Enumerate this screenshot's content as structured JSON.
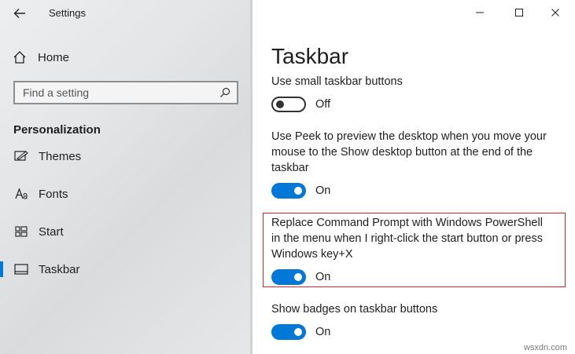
{
  "window": {
    "title": "Settings",
    "controls": [
      "minimize",
      "maximize",
      "close"
    ]
  },
  "sidebar": {
    "home_label": "Home",
    "search": {
      "placeholder": "Find a setting",
      "value": ""
    },
    "section_title": "Personalization",
    "items": [
      {
        "label": "Themes",
        "icon": "themes-icon",
        "active": false
      },
      {
        "label": "Fonts",
        "icon": "fonts-icon",
        "active": false
      },
      {
        "label": "Start",
        "icon": "start-icon",
        "active": false
      },
      {
        "label": "Taskbar",
        "icon": "taskbar-icon",
        "active": true
      }
    ]
  },
  "main": {
    "title": "Taskbar",
    "settings": [
      {
        "label": "Use small taskbar buttons",
        "state": "Off",
        "on": false
      },
      {
        "label": "Use Peek to preview the desktop when you move your mouse to the Show desktop button at the end of the taskbar",
        "state": "On",
        "on": true
      },
      {
        "label": "Replace Command Prompt with Windows PowerShell in the menu when I right-click the start button or press Windows key+X",
        "state": "On",
        "on": true,
        "highlighted": true
      },
      {
        "label": "Show badges on taskbar buttons",
        "state": "On",
        "on": true
      }
    ]
  },
  "colors": {
    "accent": "#0078d7",
    "highlight": "#d8232a"
  },
  "watermark": "wsxdn.com"
}
